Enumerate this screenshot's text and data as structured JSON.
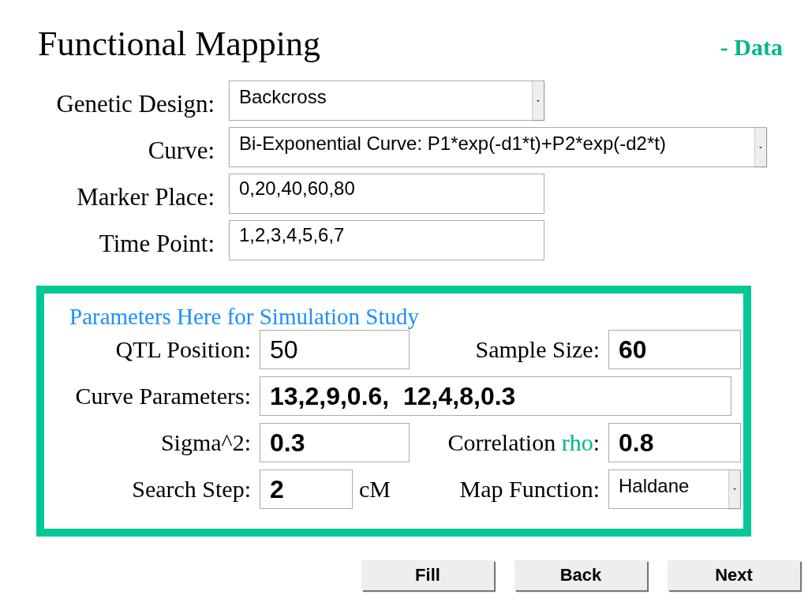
{
  "header": {
    "title": "Functional Mapping",
    "section": "- Data"
  },
  "form": [
    {
      "label": "Genetic Design:",
      "kind": "select",
      "value": "Backcross"
    },
    {
      "label": "Curve:",
      "kind": "wideselect",
      "value": "Bi-Exponential Curve: P1*exp(-d1*t)+P2*exp(-d2*t)"
    },
    {
      "label": "Marker Place:",
      "kind": "field",
      "value": "0,20,40,60,80"
    },
    {
      "label": "Time Point:",
      "kind": "field",
      "value": "1,2,3,4,5,6,7"
    }
  ],
  "panel": {
    "title": "Parameters Here for Simulation Study",
    "rows": [
      [
        {
          "kind": "label",
          "text": "QTL Position:"
        },
        {
          "kind": "field",
          "value": "50",
          "bold": false
        },
        {
          "kind": "label",
          "text": "Sample Size:"
        },
        {
          "kind": "field",
          "value": "60",
          "bold": true
        }
      ],
      [
        {
          "kind": "label",
          "text": "Curve Parameters:"
        },
        {
          "kind": "field",
          "value": "13,2,9,0.6,  12,4,8,0.3",
          "bold": true
        }
      ],
      [
        {
          "kind": "label",
          "text": "Sigma^2:"
        },
        {
          "kind": "field",
          "value": "0.3",
          "bold": true
        },
        {
          "kind": "label",
          "text": "Correlation ",
          "highlight": "rho",
          "suffix": ":"
        },
        {
          "kind": "field",
          "value": "0.8",
          "bold": true
        }
      ],
      [
        {
          "kind": "label",
          "text": "Search Step:"
        },
        {
          "kind": "field",
          "value": "2",
          "bold": true,
          "unit": "cM"
        },
        {
          "kind": "label",
          "text": "Map Function:"
        },
        {
          "kind": "select",
          "value": "Haldane"
        }
      ]
    ]
  },
  "buttons": [
    "Fill",
    "Back",
    "Next"
  ]
}
